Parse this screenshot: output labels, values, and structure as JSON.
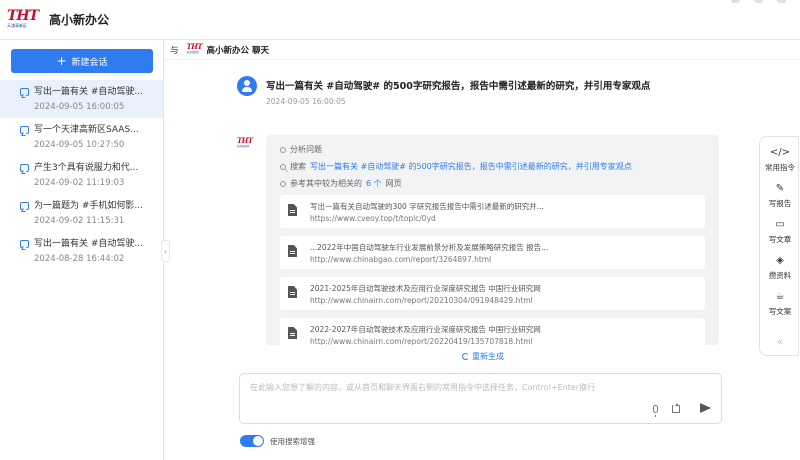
{
  "app": {
    "logo_text": "THT",
    "logo_sub": "天津高新区",
    "title": "高小新办公"
  },
  "sidebar": {
    "new_chat_label": "新建会话",
    "conversations": [
      {
        "title": "写出一篇有关 #自动驾驶...",
        "time": "2024-09-05 16:00:05"
      },
      {
        "title": "写一个天津高新区SAAS...",
        "time": "2024-09-05 10:27:50"
      },
      {
        "title": "产生3个具有说服力和代...",
        "time": "2024-09-02 11:19:03"
      },
      {
        "title": "为一篇题为 #手机如何影...",
        "time": "2024-09-02 11:15:31"
      },
      {
        "title": "写出一篇有关 #自动驾驶...",
        "time": "2024-08-28 16:44:02"
      }
    ]
  },
  "chat": {
    "with_label": "与",
    "bot_name": "高小新办公 聊天",
    "user_message": "写出一篇有关 #自动驾驶# 的500字研究报告，报告中需引述最新的研究，并引用专家观点",
    "user_time": "2024-09-05 16:00:05",
    "steps": {
      "analyze": "分析问题",
      "search_prefix": "搜索",
      "search_query": "写出一篇有关 #自动驾驶# 的500字研究报告，报告中需引述最新的研究，并引用专家观点",
      "ref_prefix": "参考其中较为相关的",
      "ref_count": "6 个",
      "ref_suffix": "网页"
    },
    "references": [
      {
        "title": "写出一篇有关自动驾驶的300 字研究报告报告中需引述最新的研究并...",
        "url": "https://www.cveoy.top/t/topic/0yd"
      },
      {
        "title": "...2022年中国自动驾驶车行业发展前景分析及发展策略研究报告 报告...",
        "url": "http://www.chinabgao.com/report/3264897.html"
      },
      {
        "title": "2021-2025年自动驾驶技术及应用行业深度研究报告 中国行业研究网",
        "url": "http://www.chinairn.com/report/20210304/091948429.html"
      },
      {
        "title": "2022-2027年自动驾驶技术及应用行业深度研究报告 中国行业研究网",
        "url": "http://www.chinairn.com/report/20220419/135707818.html"
      }
    ],
    "regenerate_label": "重新生成"
  },
  "input": {
    "placeholder": "在此输入您想了解的内容，或从首页和聊天界面右侧的常用指令中选择任务，Control+Enter换行",
    "search_toggle_label": "使用搜索增强",
    "search_toggle_on": true
  },
  "tools": [
    {
      "label": "常用指令",
      "icon": "code-icon"
    },
    {
      "label": "写报告",
      "icon": "pen-icon"
    },
    {
      "label": "写文章",
      "icon": "monitor-icon"
    },
    {
      "label": "攒资料",
      "icon": "graduation-cap-icon"
    },
    {
      "label": "写文案",
      "icon": "cup-icon"
    }
  ],
  "colors": {
    "accent": "#2f7bf0",
    "logo_red": "#c8102e"
  }
}
